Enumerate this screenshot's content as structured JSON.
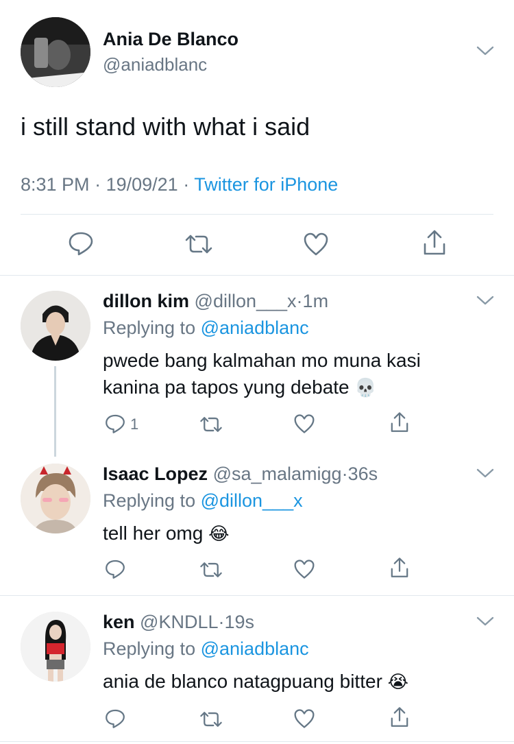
{
  "main_tweet": {
    "name": "Ania De Blanco",
    "handle": "@aniadblanc",
    "text": "i still stand with what i said",
    "time": "8:31 PM",
    "date": "19/09/21",
    "source": "Twitter for iPhone",
    "sep": "·"
  },
  "replies": [
    {
      "name": "dillon kim",
      "handle": "@dillon___x",
      "age": "1m",
      "replying_prefix": "Replying to",
      "replying_to": "@aniadblanc",
      "text_line1": "pwede bang kalmahan mo muna kasi",
      "text_line2": "kanina pa tapos yung debate",
      "emoji": "💀",
      "reply_count": "1"
    },
    {
      "name": "Isaac Lopez",
      "handle": "@sa_malamigg",
      "age": "36s",
      "replying_prefix": "Replying to",
      "replying_to": "@dillon___x",
      "text_line1": "tell her omg",
      "emoji": "😂"
    },
    {
      "name": "ken",
      "handle": "@KNDLL",
      "age": "19s",
      "replying_prefix": "Replying to",
      "replying_to": "@aniadblanc",
      "text_line1": "ania de blanco natagpuang bitter",
      "emoji": "😭"
    }
  ],
  "colors": {
    "link": "#1b95e0",
    "secondary": "#687684",
    "divider": "#e1e8ed",
    "thread_line": "#ccd6dd"
  },
  "icons": [
    "chevron-down-icon",
    "reply-icon",
    "retweet-icon",
    "like-icon",
    "share-icon"
  ]
}
